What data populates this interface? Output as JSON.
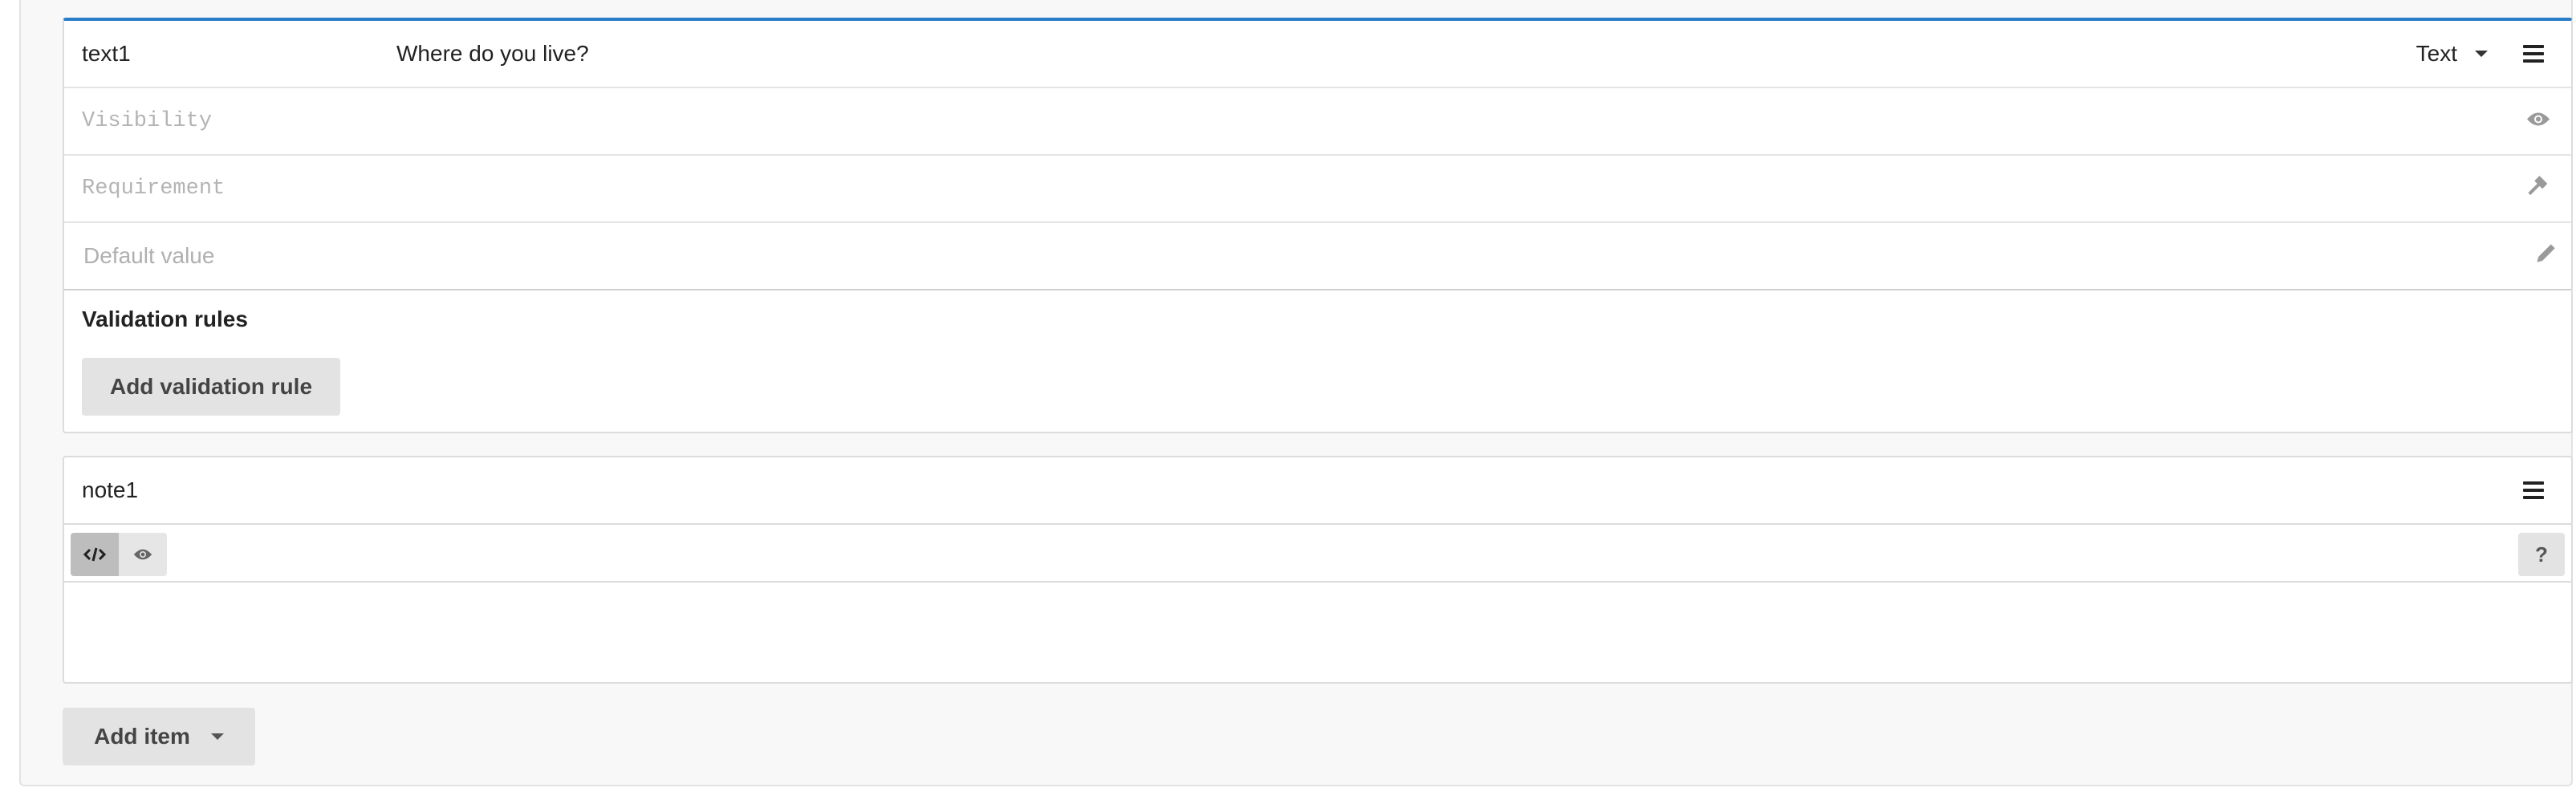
{
  "question": {
    "name": "text1",
    "title": "Where do you live?",
    "type_label": "Text",
    "visibility_placeholder": "Visibility",
    "requirement_placeholder": "Requirement",
    "default_value_placeholder": "Default value",
    "validation_heading": "Validation rules",
    "add_validation_label": "Add validation rule"
  },
  "note": {
    "name": "note1",
    "help_label": "?",
    "content": ""
  },
  "footer": {
    "add_item_label": "Add item"
  },
  "colors": {
    "accent": "#2a7dc9",
    "button_bg": "#e3e3e3",
    "placeholder": "#b0b0b0"
  }
}
